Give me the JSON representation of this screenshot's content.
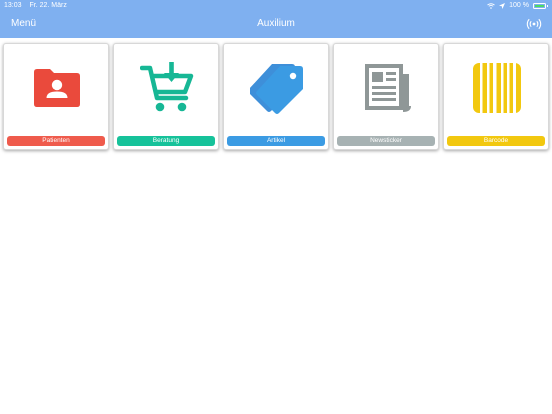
{
  "status_bar": {
    "time": "13:03",
    "date": "Fr. 22. März",
    "battery": "100 %",
    "battery_level": 1.0
  },
  "nav": {
    "menu_label": "Menü",
    "title": "Auxilium",
    "right_icon": "broadcast-icon"
  },
  "tiles": [
    {
      "label": "Patienten",
      "icon": "patient-folder-icon",
      "color": "#ef5b4c"
    },
    {
      "label": "Beratung",
      "icon": "shopping-cart-icon",
      "color": "#16c29a"
    },
    {
      "label": "Artikel",
      "icon": "price-tags-icon",
      "color": "#3b9be3"
    },
    {
      "label": "Newsticker",
      "icon": "newspaper-icon",
      "color": "#a7b2b3"
    },
    {
      "label": "Barcode",
      "icon": "barcode-icon",
      "color": "#f2c80f"
    }
  ],
  "colors": {
    "nav_background": "#7fb0f0"
  }
}
